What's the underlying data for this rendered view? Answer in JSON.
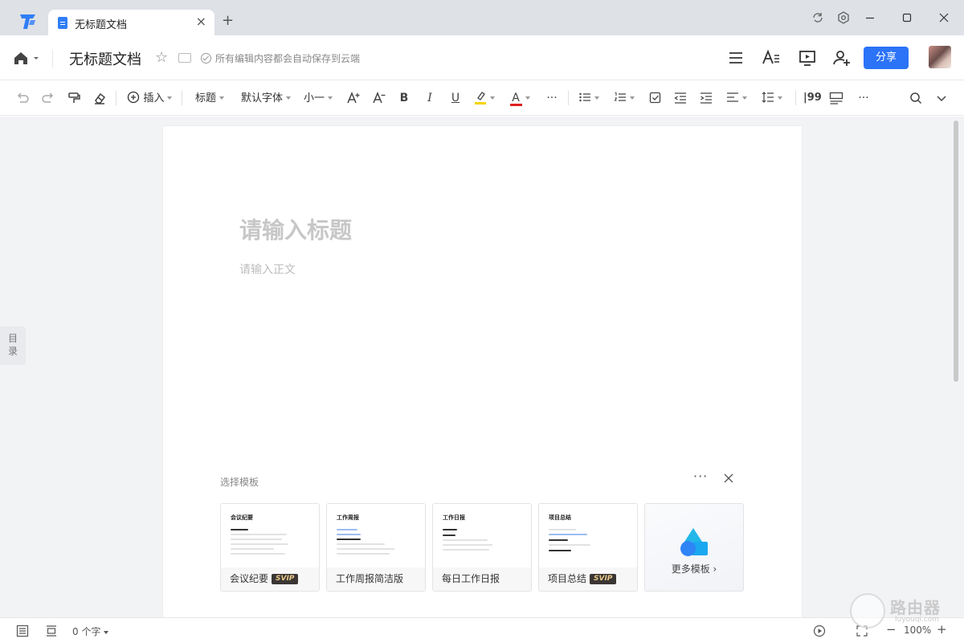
{
  "tab": {
    "title": "无标题文档",
    "close": "×",
    "new": "+"
  },
  "header": {
    "doc_title": "无标题文档",
    "save_status": "所有编辑内容都会自动保存到云端",
    "share_label": "分享"
  },
  "toolbar": {
    "insert": "插入",
    "heading": "标题",
    "font_family": "默认字体",
    "font_size": "小一",
    "bold": "B",
    "italic": "I",
    "underline": "U",
    "font_color": "A",
    "more": "···",
    "quote": "|99"
  },
  "document": {
    "title_placeholder": "请输入标题",
    "body_placeholder": "请输入正文"
  },
  "toc": {
    "label_line1": "目",
    "label_line2": "录"
  },
  "templates": {
    "label": "选择模板",
    "items": [
      {
        "name": "会议纪要",
        "preview_title": "会议纪要",
        "svip": "SVIP"
      },
      {
        "name": "工作周报简洁版",
        "preview_title": "工作周报",
        "svip": ""
      },
      {
        "name": "每日工作日报",
        "preview_title": "工作日报",
        "svip": ""
      },
      {
        "name": "项目总结",
        "preview_title": "项目总结",
        "svip": "SVIP"
      }
    ],
    "more_label": "更多模板 ›"
  },
  "statusbar": {
    "word_count": "0 个字",
    "zoom": "100%",
    "zoom_out": "−",
    "zoom_in": "+"
  },
  "watermark": {
    "text": "路由器",
    "sub": "luyouqi.com"
  },
  "colors": {
    "accent": "#2b73f7",
    "highlight_underline": "#f5d300",
    "font_color_underline": "#e02020",
    "canvas_bg": "#f2f3f5"
  }
}
